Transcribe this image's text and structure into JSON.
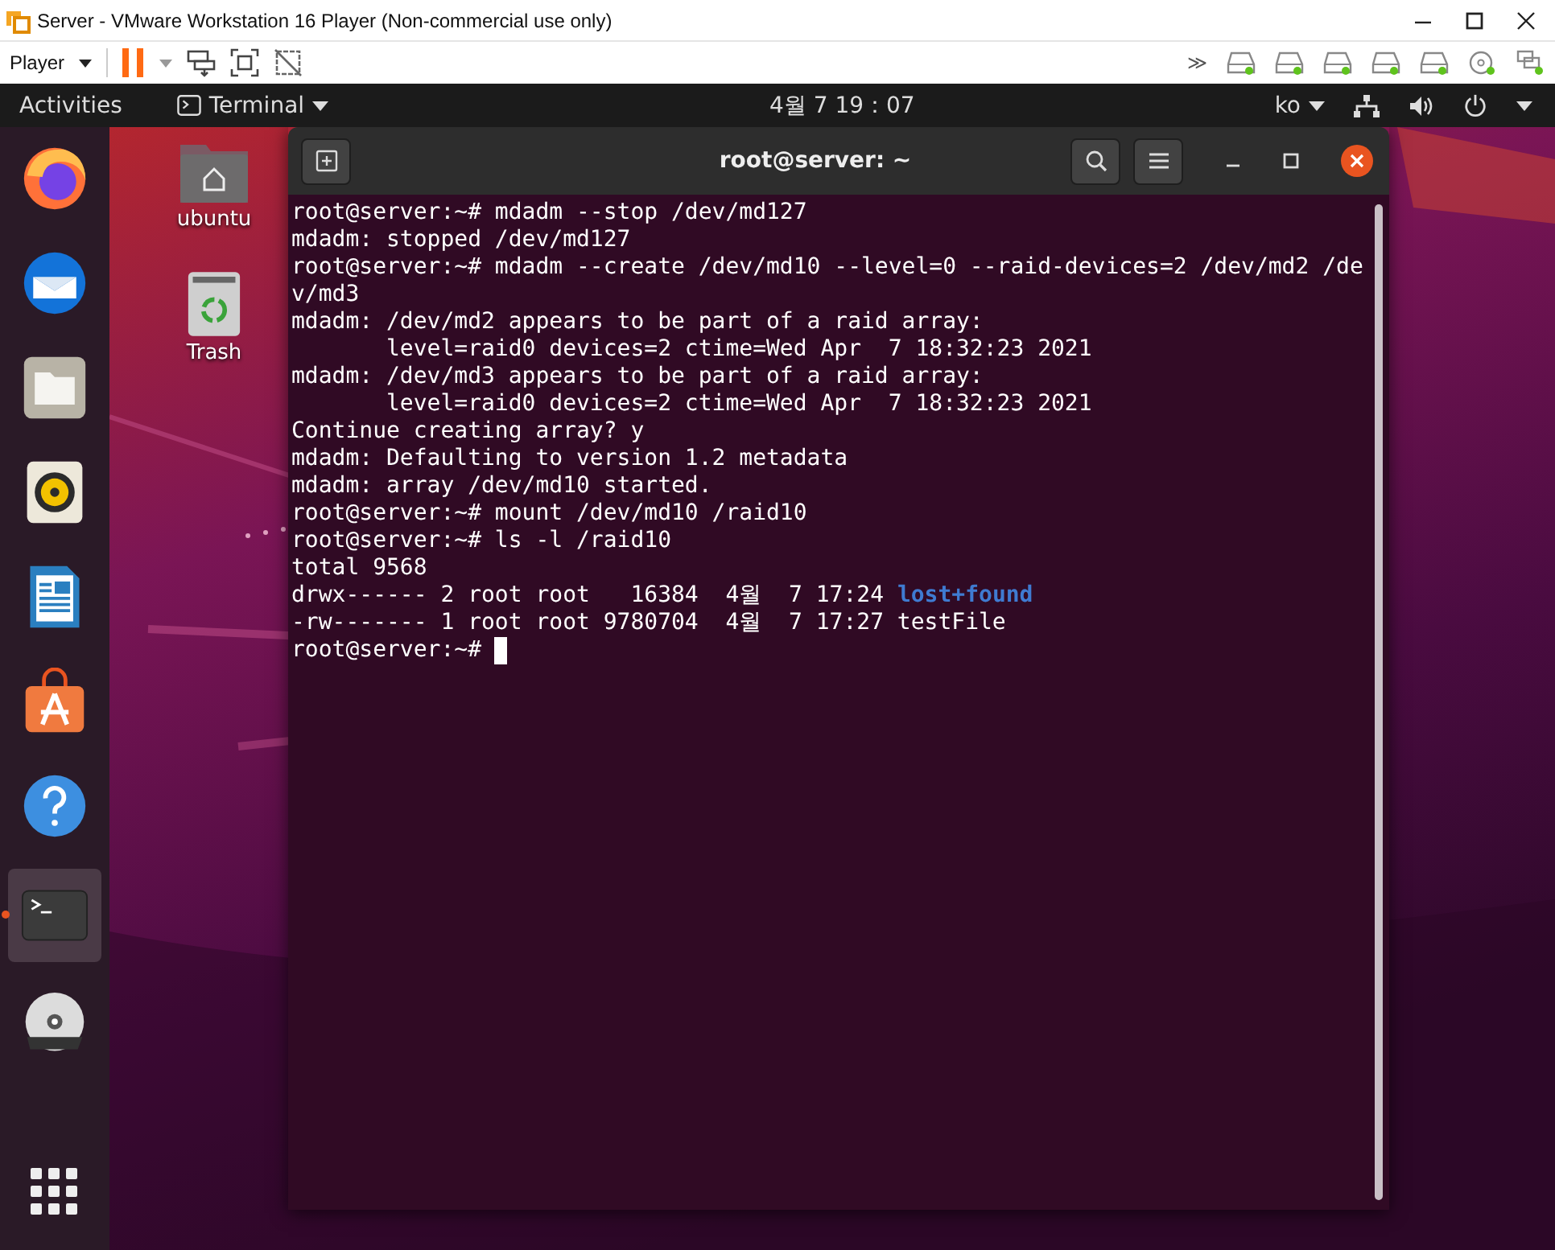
{
  "vm_window": {
    "title": "Server - VMware Workstation 16 Player (Non-commercial use only)"
  },
  "vm_toolbar": {
    "player_menu": "Player",
    "overflow": "≫"
  },
  "top_bar": {
    "activities": "Activities",
    "app_menu": "Terminal",
    "clock": "4월 7  19：07",
    "input_method": "ko"
  },
  "dock": [
    {
      "kind": "browser",
      "selected": false
    },
    {
      "kind": "mail",
      "selected": false
    },
    {
      "kind": "files",
      "selected": false
    },
    {
      "kind": "music",
      "selected": false
    },
    {
      "kind": "writer",
      "selected": false
    },
    {
      "kind": "software",
      "selected": false
    },
    {
      "kind": "help",
      "selected": false
    },
    {
      "kind": "terminal",
      "selected": true
    },
    {
      "kind": "dvd",
      "selected": false
    }
  ],
  "desktop_icons": [
    {
      "kind": "home",
      "label": "ubuntu"
    },
    {
      "kind": "trash",
      "label": "Trash"
    }
  ],
  "terminal": {
    "title": "root@server: ~",
    "lines": [
      {
        "text": "root@server:~# mdadm --stop /dev/md127"
      },
      {
        "text": "mdadm: stopped /dev/md127"
      },
      {
        "text": "root@server:~# mdadm --create /dev/md10 --level=0 --raid-devices=2 /dev/md2 /de"
      },
      {
        "text": "v/md3"
      },
      {
        "text": "mdadm: /dev/md2 appears to be part of a raid array:"
      },
      {
        "text": "       level=raid0 devices=2 ctime=Wed Apr  7 18:32:23 2021"
      },
      {
        "text": "mdadm: /dev/md3 appears to be part of a raid array:"
      },
      {
        "text": "       level=raid0 devices=2 ctime=Wed Apr  7 18:32:23 2021"
      },
      {
        "text": "Continue creating array? y"
      },
      {
        "text": "mdadm: Defaulting to version 1.2 metadata"
      },
      {
        "text": "mdadm: array /dev/md10 started."
      },
      {
        "text": "root@server:~# mount /dev/md10 /raid10"
      },
      {
        "text": "root@server:~# ls -l /raid10"
      },
      {
        "text": "total 9568"
      },
      {
        "text": "drwx------ 2 root root   16384  4월  7 17:24 ",
        "directory": "lost+found"
      },
      {
        "text": "-rw------- 1 root root 9780704  4월  7 17:27 testFile"
      },
      {
        "text": "root@server:~# ",
        "cursor": true
      }
    ]
  }
}
